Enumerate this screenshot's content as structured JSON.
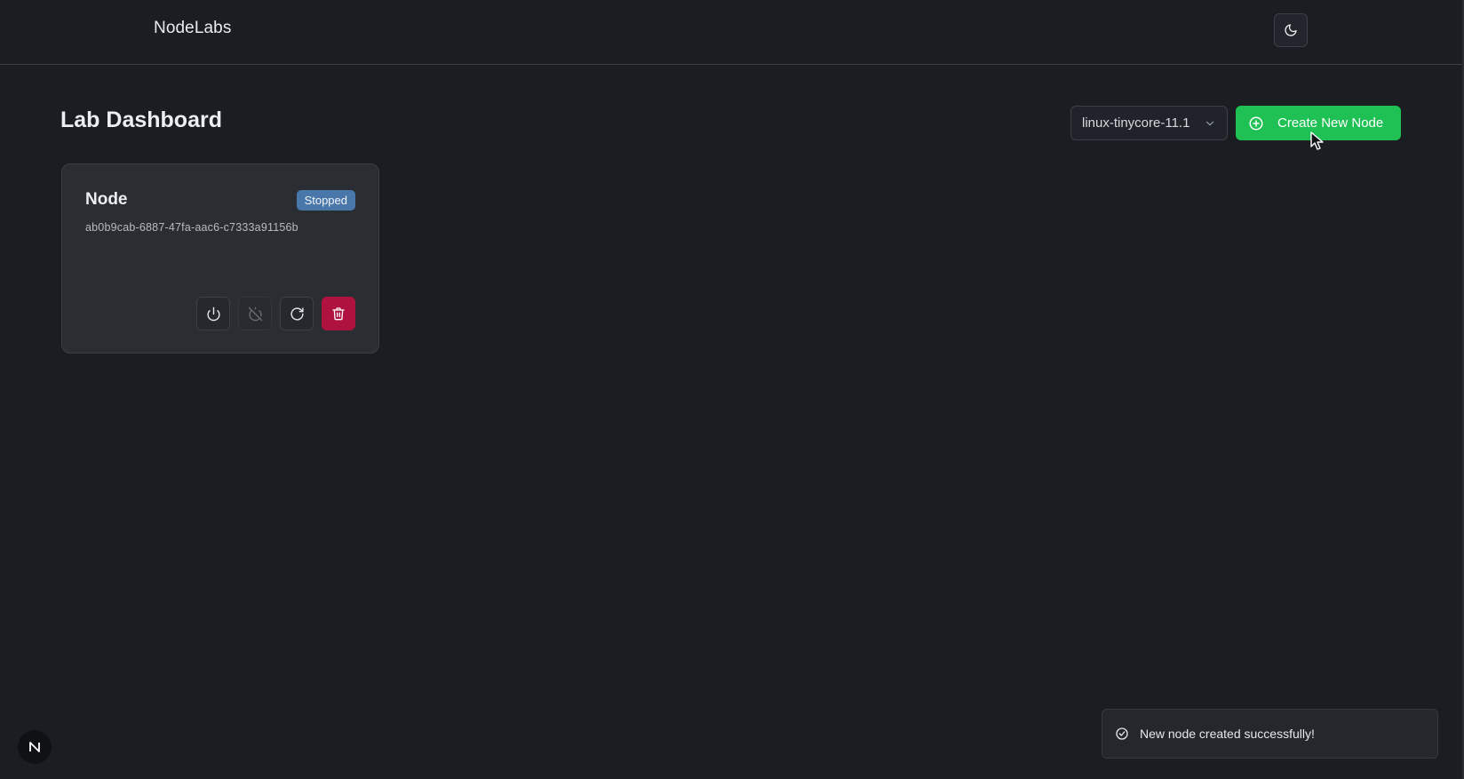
{
  "header": {
    "brand": "NodeLabs",
    "theme_toggle_icon": "moon-icon"
  },
  "main": {
    "title": "Lab Dashboard",
    "image_select": {
      "value": "linux-tinycore-11.1",
      "icon": "chevron-down-icon"
    },
    "create_button": {
      "label": "Create New Node",
      "icon": "plus-circle-icon",
      "color": "#1fc155"
    }
  },
  "nodes": [
    {
      "name": "Node",
      "status": "Stopped",
      "status_color": "#4a77aa",
      "id": "ab0b9cab-6887-47fa-aac6-c7333a91156b",
      "actions": [
        {
          "icon": "power-icon",
          "enabled": true
        },
        {
          "icon": "power-off-disabled-icon",
          "enabled": false
        },
        {
          "icon": "refresh-icon",
          "enabled": true
        },
        {
          "icon": "trash-icon",
          "enabled": true,
          "color": "#b0123f"
        }
      ]
    }
  ],
  "toast": {
    "message": "New node created successfully!",
    "icon": "check-circle-icon"
  },
  "dev_indicator": {
    "label": "N"
  }
}
